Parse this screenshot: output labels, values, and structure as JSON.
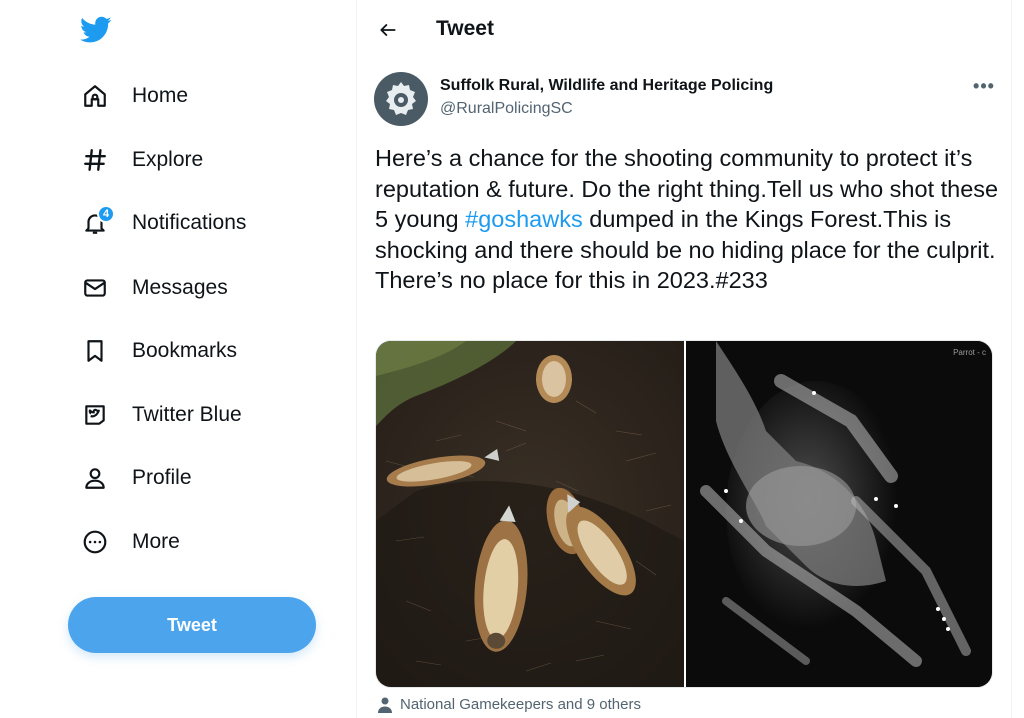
{
  "nav": {
    "items": [
      {
        "label": "Home",
        "icon": "home-icon"
      },
      {
        "label": "Explore",
        "icon": "hashtag-icon"
      },
      {
        "label": "Notifications",
        "icon": "bell-icon",
        "badge": "4"
      },
      {
        "label": "Messages",
        "icon": "envelope-icon"
      },
      {
        "label": "Bookmarks",
        "icon": "bookmark-icon"
      },
      {
        "label": "Twitter Blue",
        "icon": "twitter-blue-icon"
      },
      {
        "label": "Profile",
        "icon": "person-icon"
      },
      {
        "label": "More",
        "icon": "more-circle-icon"
      }
    ],
    "tweet_button": "Tweet"
  },
  "header": {
    "title": "Tweet"
  },
  "tweet": {
    "author_name": "Suffolk Rural, Wildlife and Heritage Policing",
    "author_handle": "@RuralPolicingSC",
    "text_part1": "Here’s a chance for the shooting community to protect it’s reputation & future. Do the right thing.Tell us who shot these 5 young ",
    "hashtag": "#goshawks",
    "text_part2": " dumped in the Kings Forest.This is shocking and there should be no hiding place for the culprit. There’s no place for this in 2023.#233",
    "media_right_label": "Parrot - c",
    "tagged": "National Gamekeepers and 9 others"
  },
  "colors": {
    "accent": "#1d9bf0",
    "tweet_button": "#4ca4ec",
    "text_primary": "#0f1419",
    "text_secondary": "#536471"
  }
}
